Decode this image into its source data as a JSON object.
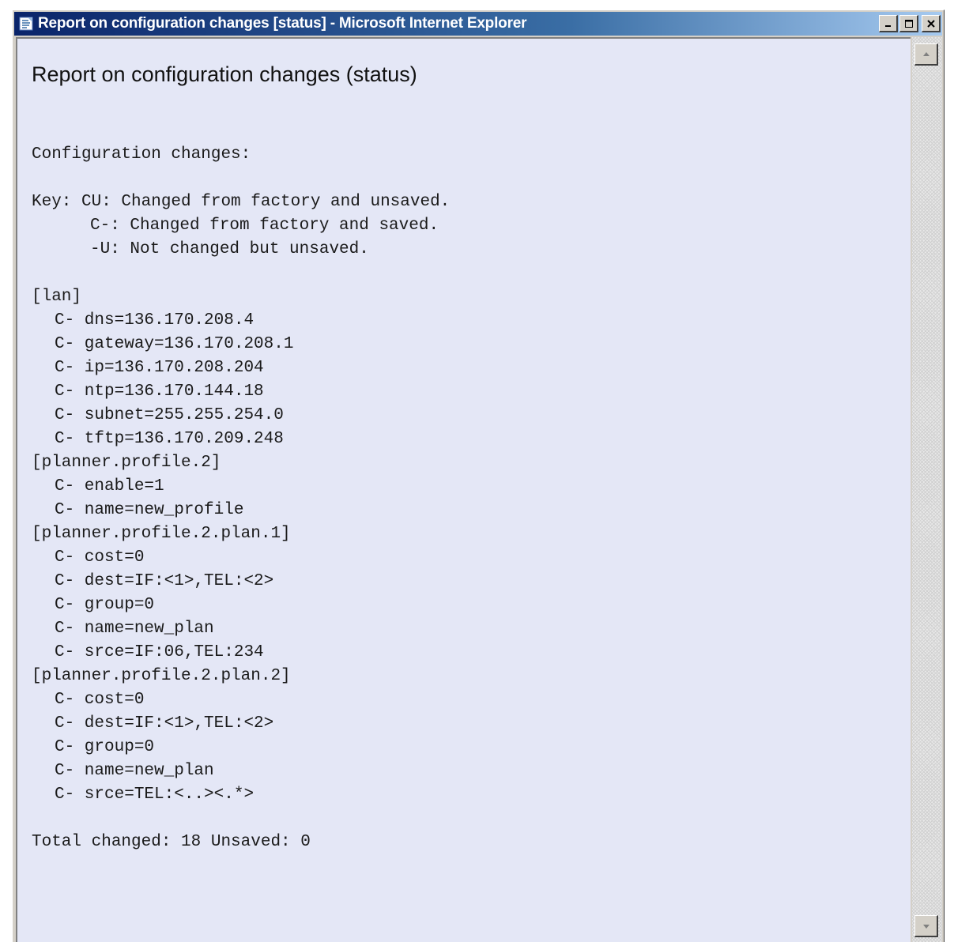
{
  "window": {
    "title": "Report on configuration changes [status] - Microsoft Internet Explorer",
    "controls": [
      "minimize-icon",
      "maximize-icon",
      "close-icon"
    ]
  },
  "page": {
    "heading": "Report on configuration changes (status)",
    "intro": "Configuration changes:",
    "key": {
      "line1": "Key: CU: Changed from factory and unsaved.",
      "line2": "C-: Changed from factory and saved.",
      "line3": "-U: Not changed but unsaved."
    },
    "sections": [
      {
        "header": "[lan]",
        "entries": [
          "C- dns=136.170.208.4",
          "C- gateway=136.170.208.1",
          "C- ip=136.170.208.204",
          "C- ntp=136.170.144.18",
          "C- subnet=255.255.254.0",
          "C- tftp=136.170.209.248"
        ]
      },
      {
        "header": "[planner.profile.2]",
        "entries": [
          "C- enable=1",
          "C- name=new_profile"
        ]
      },
      {
        "header": "[planner.profile.2.plan.1]",
        "entries": [
          "C- cost=0",
          "C- dest=IF:<1>,TEL:<2>",
          "C- group=0",
          "C- name=new_plan",
          "C- srce=IF:06,TEL:234"
        ]
      },
      {
        "header": "[planner.profile.2.plan.2]",
        "entries": [
          "C- cost=0",
          "C- dest=IF:<1>,TEL:<2>",
          "C- group=0",
          "C- name=new_plan",
          "C- srce=TEL:<..><.*>"
        ]
      }
    ],
    "total": "Total changed: 18 Unsaved: 0"
  },
  "colors": {
    "titlebar_start": "#0a246a",
    "titlebar_end": "#a6caf0",
    "content_bg": "#e4e7f6",
    "chrome": "#d4d0c8"
  }
}
